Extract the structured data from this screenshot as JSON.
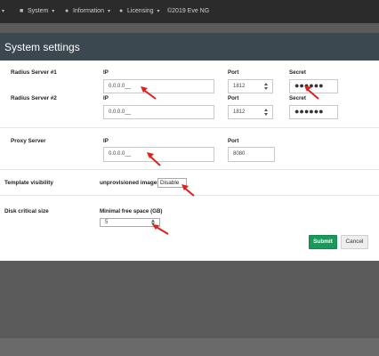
{
  "nav": {
    "items": [
      {
        "icon": "book-icon",
        "glyph": "■",
        "label": "System",
        "caret": "▾"
      },
      {
        "icon": "info-icon",
        "glyph": "●",
        "label": "Information",
        "caret": "▾"
      },
      {
        "icon": "info-icon",
        "glyph": "●",
        "label": "Licensing",
        "caret": "▾"
      }
    ],
    "left_caret": "▾",
    "copyright": "©2019 Eve NG"
  },
  "modal": {
    "title": "System settings"
  },
  "radius1": {
    "label": "Radius Server #1",
    "ip_head": "IP",
    "ip_value": "0.0.0.0__",
    "port_head": "Port",
    "port_value": "1812",
    "secret_head": "Secret",
    "secret_value": "●●●●●●"
  },
  "radius2": {
    "label": "Radius Server #2",
    "ip_head": "IP",
    "ip_value": "0.0.0.0__",
    "port_head": "Port",
    "port_value": "1812",
    "secret_head": "Secret",
    "secret_value": "●●●●●●"
  },
  "proxy": {
    "label": "Proxy Server",
    "ip_head": "IP",
    "ip_value": "0.0.0.0__",
    "port_head": "Port",
    "port_value": "8080"
  },
  "template_visibility": {
    "label": "Template visibility",
    "field_label": "unprovisioned images",
    "selected": "Disable"
  },
  "disk": {
    "label": "Disk critical size",
    "field_label": "Minimal free space (GB)",
    "value": "5"
  },
  "buttons": {
    "submit": "Submit",
    "cancel": "Cancel"
  },
  "colors": {
    "nav_bg": "#2b2b2b",
    "header_bg": "#3b4850",
    "submit_bg": "#1a9a5a",
    "arrow": "#e0201c"
  }
}
